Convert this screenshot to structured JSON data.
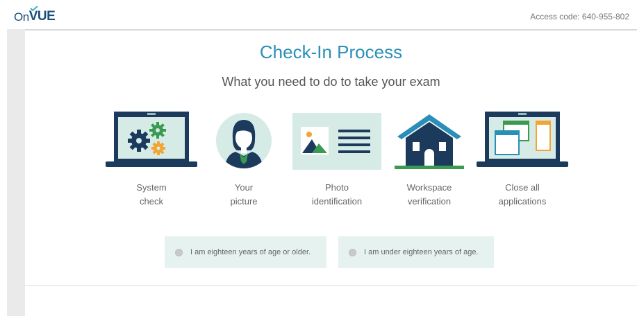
{
  "header": {
    "logo_on": "On",
    "logo_vue": "VUE",
    "access_code": "Access code: 640-955-802"
  },
  "main": {
    "title": "Check-In Process",
    "subtitle": "What you need to do to take your exam",
    "steps": [
      {
        "line1": "System",
        "line2": "check",
        "icon": "laptop-gears-icon"
      },
      {
        "line1": "Your",
        "line2": "picture",
        "icon": "person-portrait-icon"
      },
      {
        "line1": "Photo",
        "line2": "identification",
        "icon": "id-card-icon"
      },
      {
        "line1": "Workspace",
        "line2": "verification",
        "icon": "house-icon"
      },
      {
        "line1": "Close all",
        "line2": "applications",
        "icon": "laptop-windows-icon"
      }
    ],
    "age_options": [
      {
        "label": "I am eighteen years of age or older."
      },
      {
        "label": "I am under eighteen years of age."
      }
    ]
  },
  "colors": {
    "accent": "#2a8fb7",
    "navy": "#1b3a5c",
    "green": "#3a9a52",
    "option_bg": "#e6f2ef"
  }
}
